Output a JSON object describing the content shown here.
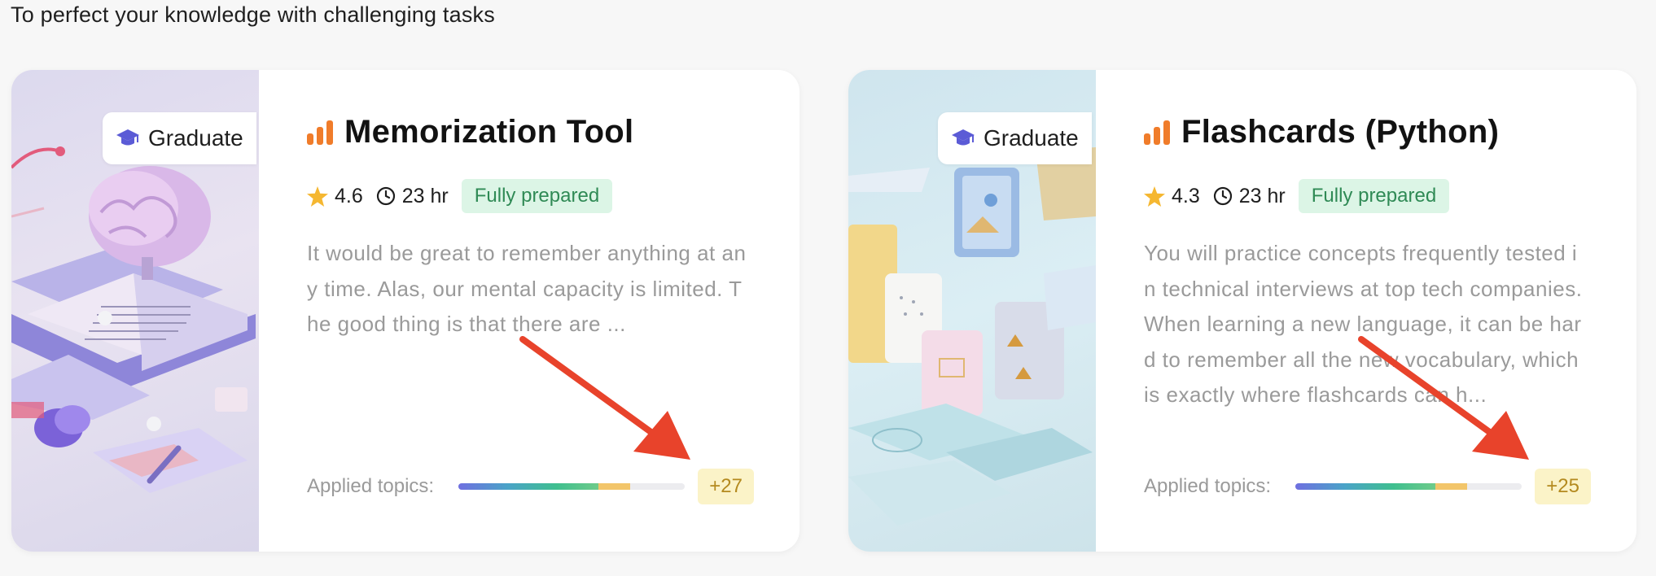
{
  "section": {
    "subtitle": "To perfect your knowledge with challenging tasks"
  },
  "cards": [
    {
      "badge": "Graduate",
      "title": "Memorization Tool",
      "rating": "4.6",
      "duration": "23 hr",
      "status": "Fully prepared",
      "description": "It would be great to remember anything at any time. Alas, our mental capacity is limited. The good thing is that there are ...",
      "topics_label": "Applied topics:",
      "topics_count": "+27",
      "topics_progress": 0.62
    },
    {
      "badge": "Graduate",
      "title": "Flashcards (Python)",
      "rating": "4.3",
      "duration": "23 hr",
      "status": "Fully prepared",
      "description_lines": [
        "You will practice concepts frequently tested in technical interviews at top tech companies.",
        "When learning a new language, it can be hard to remember all the new vocabulary, which is exactly where flashcards can h..."
      ],
      "topics_label": "Applied topics:",
      "topics_count": "+25",
      "topics_progress": 0.62
    }
  ],
  "colors": {
    "accent_orange": "#f07c2a",
    "badge_icon": "#5b5bd6",
    "pill_bg": "#dcf5e6",
    "pill_text": "#2f8a55",
    "count_bg": "#fbf3c8",
    "count_text": "#b48a1f",
    "arrow_red": "#e8432b"
  }
}
